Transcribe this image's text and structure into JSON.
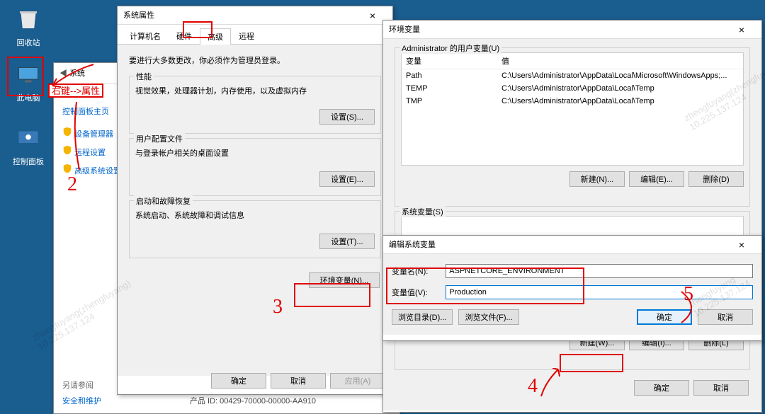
{
  "desktop": {
    "recycle": "回收站",
    "computer": "此电脑",
    "control": "控制面板"
  },
  "sysWindow": {
    "breadcrumb": "系统",
    "cp_home": "控制面板主页",
    "links": [
      "设备管理器",
      "远程设置",
      "高级系统设置"
    ],
    "seealso_title": "另请参阅",
    "seealso": "安全和维护",
    "product_id": "产品 ID: 00429-70000-00000-AA910",
    "annotation": "右键-->属性"
  },
  "sysProps": {
    "title": "系统属性",
    "tabs": [
      "计算机名",
      "硬件",
      "高级",
      "远程"
    ],
    "note": "要进行大多数更改，你必须作为管理员登录。",
    "perf": {
      "title": "性能",
      "desc": "视觉效果，处理器计划，内存使用，以及虚拟内存",
      "btn": "设置(S)..."
    },
    "profile": {
      "title": "用户配置文件",
      "desc": "与登录帐户相关的桌面设置",
      "btn": "设置(E)..."
    },
    "startup": {
      "title": "启动和故障恢复",
      "desc": "系统启动、系统故障和调试信息",
      "btn": "设置(T)..."
    },
    "env_btn": "环境变量(N)...",
    "ok": "确定",
    "cancel": "取消",
    "apply": "应用(A)"
  },
  "envVars": {
    "title": "环境变量",
    "user_title": "Administrator 的用户变量(U)",
    "col_name": "变量",
    "col_value": "值",
    "user_rows": [
      {
        "name": "Path",
        "value": "C:\\Users\\Administrator\\AppData\\Local\\Microsoft\\WindowsApps;..."
      },
      {
        "name": "TEMP",
        "value": "C:\\Users\\Administrator\\AppData\\Local\\Temp"
      },
      {
        "name": "TMP",
        "value": "C:\\Users\\Administrator\\AppData\\Local\\Temp"
      }
    ],
    "btn_new": "新建(N)...",
    "btn_edit": "编辑(E)...",
    "btn_del": "删除(D)",
    "sys_title": "系统变量(S)",
    "btn_new_sys": "新建(W)...",
    "btn_edit_sys": "编辑(I)...",
    "btn_del_sys": "删除(L)",
    "ok": "确定",
    "cancel": "取消"
  },
  "editVar": {
    "title": "编辑系统变量",
    "name_lbl": "变量名(N):",
    "name_val": "ASPNETCORE_ENVIRONMENT",
    "val_lbl": "变量值(V):",
    "val_val": "Production",
    "browse_dir": "浏览目录(D)...",
    "browse_file": "浏览文件(F)...",
    "ok": "确定",
    "cancel": "取消"
  }
}
